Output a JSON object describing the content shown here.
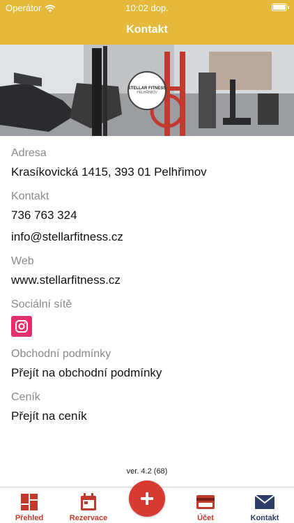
{
  "status_bar": {
    "carrier": "Operátor",
    "time": "10:02 dop."
  },
  "header": {
    "title": "Kontakt"
  },
  "hero": {
    "logo_text": "STELLAR FITNESS",
    "logo_sub": "PELHŘIMOV"
  },
  "sections": {
    "address_label": "Adresa",
    "address_value": "Krasíkovická 1415, 393 01 Pelhřimov",
    "contact_label": "Kontakt",
    "phone": "736 763 324",
    "email": "info@stellarfitness.cz",
    "web_label": "Web",
    "web_value": "www.stellarfitness.cz",
    "social_label": "Sociální sítě",
    "terms_label": "Obchodní podmínky",
    "terms_link": "Přejít na obchodní podmínky",
    "pricing_label": "Ceník",
    "pricing_link": "Přejít na ceník"
  },
  "version": "ver. 4.2 (68)",
  "tabs": {
    "overview": "Přehled",
    "reservations": "Rezervace",
    "account": "Účet",
    "contact": "Kontakt"
  },
  "colors": {
    "brand": "#e4b93c",
    "accent": "#d63a31",
    "active_tab": "#2c3e66"
  }
}
